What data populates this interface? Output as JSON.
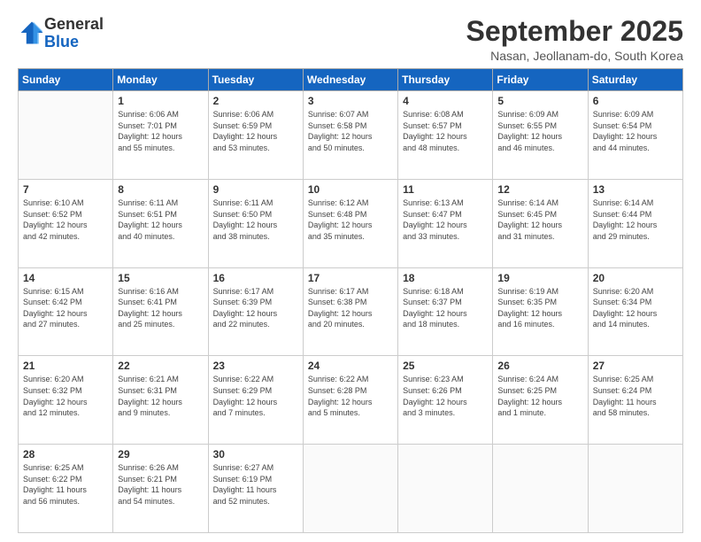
{
  "header": {
    "logo": {
      "general": "General",
      "blue": "Blue"
    },
    "title": "September 2025",
    "location": "Nasan, Jeollanam-do, South Korea"
  },
  "calendar": {
    "weekdays": [
      "Sunday",
      "Monday",
      "Tuesday",
      "Wednesday",
      "Thursday",
      "Friday",
      "Saturday"
    ],
    "weeks": [
      [
        {
          "day": "",
          "info": ""
        },
        {
          "day": "1",
          "info": "Sunrise: 6:06 AM\nSunset: 7:01 PM\nDaylight: 12 hours\nand 55 minutes."
        },
        {
          "day": "2",
          "info": "Sunrise: 6:06 AM\nSunset: 6:59 PM\nDaylight: 12 hours\nand 53 minutes."
        },
        {
          "day": "3",
          "info": "Sunrise: 6:07 AM\nSunset: 6:58 PM\nDaylight: 12 hours\nand 50 minutes."
        },
        {
          "day": "4",
          "info": "Sunrise: 6:08 AM\nSunset: 6:57 PM\nDaylight: 12 hours\nand 48 minutes."
        },
        {
          "day": "5",
          "info": "Sunrise: 6:09 AM\nSunset: 6:55 PM\nDaylight: 12 hours\nand 46 minutes."
        },
        {
          "day": "6",
          "info": "Sunrise: 6:09 AM\nSunset: 6:54 PM\nDaylight: 12 hours\nand 44 minutes."
        }
      ],
      [
        {
          "day": "7",
          "info": "Sunrise: 6:10 AM\nSunset: 6:52 PM\nDaylight: 12 hours\nand 42 minutes."
        },
        {
          "day": "8",
          "info": "Sunrise: 6:11 AM\nSunset: 6:51 PM\nDaylight: 12 hours\nand 40 minutes."
        },
        {
          "day": "9",
          "info": "Sunrise: 6:11 AM\nSunset: 6:50 PM\nDaylight: 12 hours\nand 38 minutes."
        },
        {
          "day": "10",
          "info": "Sunrise: 6:12 AM\nSunset: 6:48 PM\nDaylight: 12 hours\nand 35 minutes."
        },
        {
          "day": "11",
          "info": "Sunrise: 6:13 AM\nSunset: 6:47 PM\nDaylight: 12 hours\nand 33 minutes."
        },
        {
          "day": "12",
          "info": "Sunrise: 6:14 AM\nSunset: 6:45 PM\nDaylight: 12 hours\nand 31 minutes."
        },
        {
          "day": "13",
          "info": "Sunrise: 6:14 AM\nSunset: 6:44 PM\nDaylight: 12 hours\nand 29 minutes."
        }
      ],
      [
        {
          "day": "14",
          "info": "Sunrise: 6:15 AM\nSunset: 6:42 PM\nDaylight: 12 hours\nand 27 minutes."
        },
        {
          "day": "15",
          "info": "Sunrise: 6:16 AM\nSunset: 6:41 PM\nDaylight: 12 hours\nand 25 minutes."
        },
        {
          "day": "16",
          "info": "Sunrise: 6:17 AM\nSunset: 6:39 PM\nDaylight: 12 hours\nand 22 minutes."
        },
        {
          "day": "17",
          "info": "Sunrise: 6:17 AM\nSunset: 6:38 PM\nDaylight: 12 hours\nand 20 minutes."
        },
        {
          "day": "18",
          "info": "Sunrise: 6:18 AM\nSunset: 6:37 PM\nDaylight: 12 hours\nand 18 minutes."
        },
        {
          "day": "19",
          "info": "Sunrise: 6:19 AM\nSunset: 6:35 PM\nDaylight: 12 hours\nand 16 minutes."
        },
        {
          "day": "20",
          "info": "Sunrise: 6:20 AM\nSunset: 6:34 PM\nDaylight: 12 hours\nand 14 minutes."
        }
      ],
      [
        {
          "day": "21",
          "info": "Sunrise: 6:20 AM\nSunset: 6:32 PM\nDaylight: 12 hours\nand 12 minutes."
        },
        {
          "day": "22",
          "info": "Sunrise: 6:21 AM\nSunset: 6:31 PM\nDaylight: 12 hours\nand 9 minutes."
        },
        {
          "day": "23",
          "info": "Sunrise: 6:22 AM\nSunset: 6:29 PM\nDaylight: 12 hours\nand 7 minutes."
        },
        {
          "day": "24",
          "info": "Sunrise: 6:22 AM\nSunset: 6:28 PM\nDaylight: 12 hours\nand 5 minutes."
        },
        {
          "day": "25",
          "info": "Sunrise: 6:23 AM\nSunset: 6:26 PM\nDaylight: 12 hours\nand 3 minutes."
        },
        {
          "day": "26",
          "info": "Sunrise: 6:24 AM\nSunset: 6:25 PM\nDaylight: 12 hours\nand 1 minute."
        },
        {
          "day": "27",
          "info": "Sunrise: 6:25 AM\nSunset: 6:24 PM\nDaylight: 11 hours\nand 58 minutes."
        }
      ],
      [
        {
          "day": "28",
          "info": "Sunrise: 6:25 AM\nSunset: 6:22 PM\nDaylight: 11 hours\nand 56 minutes."
        },
        {
          "day": "29",
          "info": "Sunrise: 6:26 AM\nSunset: 6:21 PM\nDaylight: 11 hours\nand 54 minutes."
        },
        {
          "day": "30",
          "info": "Sunrise: 6:27 AM\nSunset: 6:19 PM\nDaylight: 11 hours\nand 52 minutes."
        },
        {
          "day": "",
          "info": ""
        },
        {
          "day": "",
          "info": ""
        },
        {
          "day": "",
          "info": ""
        },
        {
          "day": "",
          "info": ""
        }
      ]
    ]
  }
}
